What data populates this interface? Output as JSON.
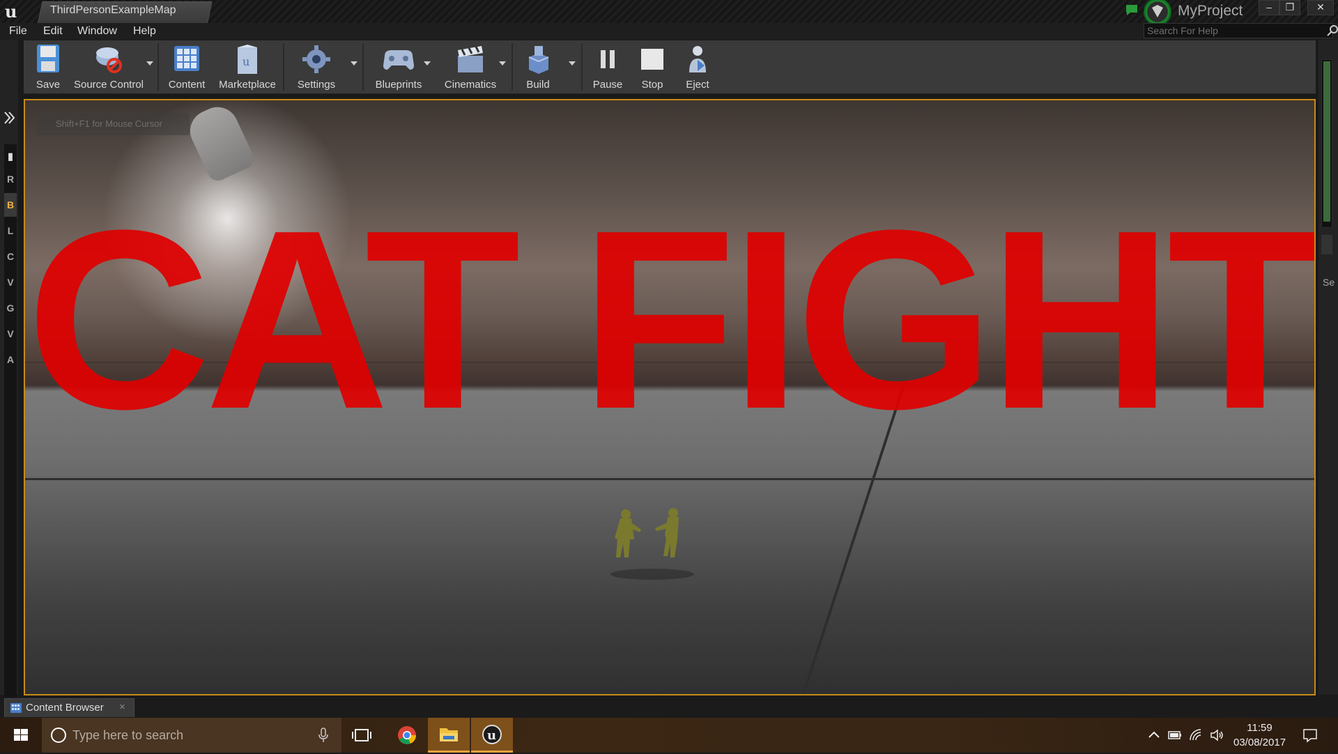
{
  "window": {
    "tab_title": "ThirdPersonExampleMap",
    "project_name": "MyProject",
    "controls": {
      "minimize": "–",
      "restore": "❐",
      "close": "✕"
    }
  },
  "menu": {
    "items": [
      "File",
      "Edit",
      "Window",
      "Help"
    ]
  },
  "help_search": {
    "placeholder": "Search For Help"
  },
  "toolbar": {
    "save": "Save",
    "source_control": "Source Control",
    "content": "Content",
    "marketplace": "Marketplace",
    "settings": "Settings",
    "blueprints": "Blueprints",
    "cinematics": "Cinematics",
    "build": "Build",
    "pause": "Pause",
    "stop": "Stop",
    "eject": "Eject"
  },
  "mode_tabs": [
    "R",
    "B",
    "L",
    "C",
    "V",
    "G",
    "V",
    "A"
  ],
  "viewport": {
    "hint": "Shift+F1 for Mouse Cursor",
    "overlay_title": "CAT FIGHT"
  },
  "right_panel": {
    "label": "Se"
  },
  "bottom_tab": {
    "label": "Content Browser",
    "close": "×"
  },
  "taskbar": {
    "search_placeholder": "Type here to search",
    "time": "11:59",
    "date": "03/08/2017"
  },
  "colors": {
    "accent_orange": "#c88a17",
    "title_red": "#e00000",
    "source_status_green": "#1a8f2e"
  }
}
